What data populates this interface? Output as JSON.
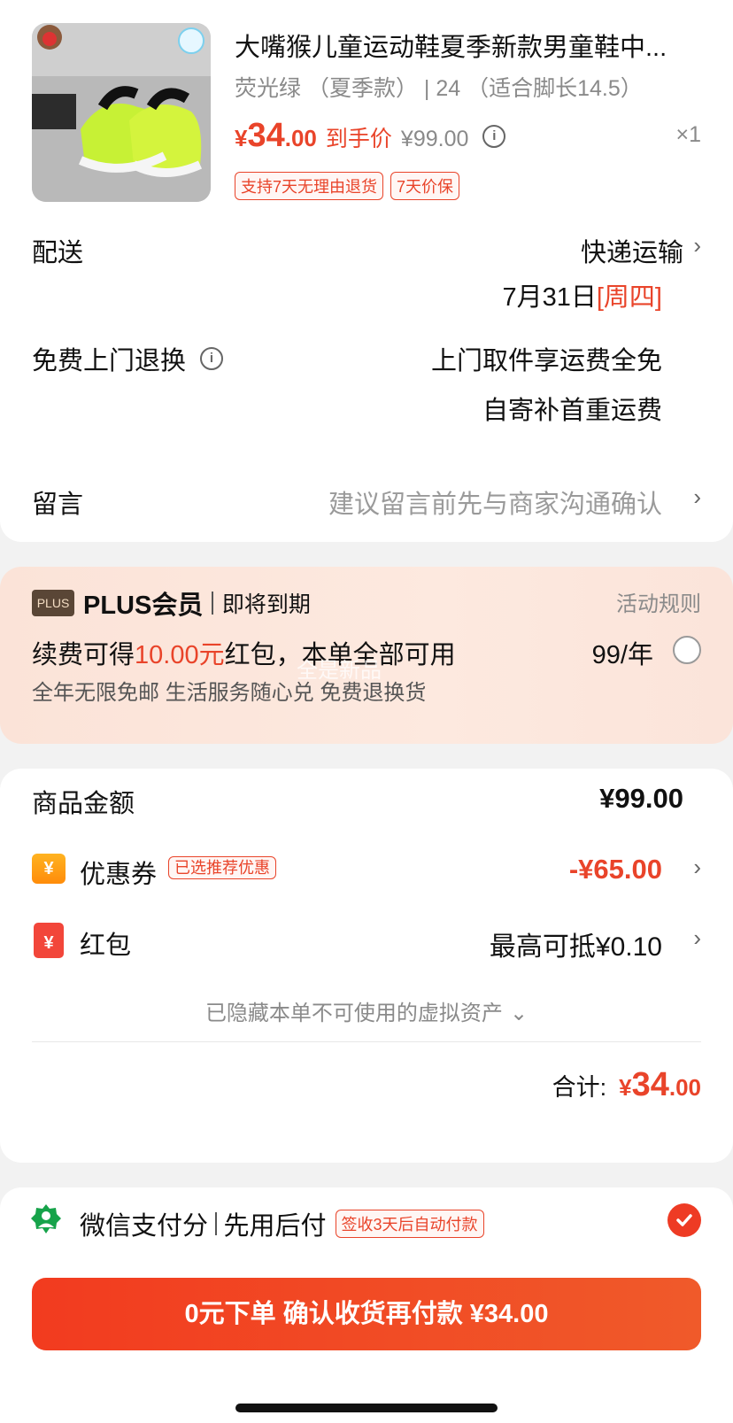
{
  "product": {
    "title": "大嘴猴儿童运动鞋夏季新款男童鞋中...",
    "sku": "荧光绿 （夏季款） | 24 （适合脚长14.5）",
    "price_symbol": "¥",
    "price_int": "34",
    "price_dec": ".00",
    "price_label": "到手价",
    "original_price": "¥99.00",
    "info_icon": "i",
    "quantity": "×1",
    "tags": [
      "支持7天无理由退货",
      "7天价保"
    ]
  },
  "delivery": {
    "label": "配送",
    "method": "快递运输",
    "date": "7月31日",
    "weekday": "[周四]"
  },
  "return_service": {
    "label": "免费上门退换",
    "line1": "上门取件享运费全免",
    "line2": "自寄补首重运费"
  },
  "note": {
    "label": "留言",
    "placeholder": "建议留言前先与商家沟通确认"
  },
  "plus": {
    "badge": "PLUS",
    "title": "PLUS会员",
    "status": "即将到期",
    "rules_link": "活动规则",
    "renew_prefix": "续费可得",
    "renew_amount": "10.00元",
    "renew_suffix": "红包，本单全部可用",
    "price": "99/年",
    "benefits": "全年无限免邮 生活服务随心兑 免费退换货",
    "watermark": "全是新品"
  },
  "amount": {
    "goods_label": "商品金额",
    "goods_value": "¥99.00",
    "coupon_label": "优惠券",
    "coupon_tag": "已选推荐优惠",
    "coupon_value": "-¥65.00",
    "redpacket_label": "红包",
    "redpacket_value": "最高可抵¥0.10",
    "hidden_assets": "已隐藏本单不可使用的虚拟资产",
    "total_label": "合计:",
    "total_symbol": "¥",
    "total_int": "34",
    "total_dec": ".00",
    "coupon_icon": "¥",
    "redpacket_icon": "¥"
  },
  "payment": {
    "method": "微信支付分",
    "sub": "先用后付",
    "tag": "签收3天后自动付款"
  },
  "submit": {
    "label": "0元下单 确认收货再付款 ¥34.00"
  },
  "colors": {
    "accent": "#e9442a",
    "button": "#f23b1f",
    "muted": "#9a9a9a"
  }
}
